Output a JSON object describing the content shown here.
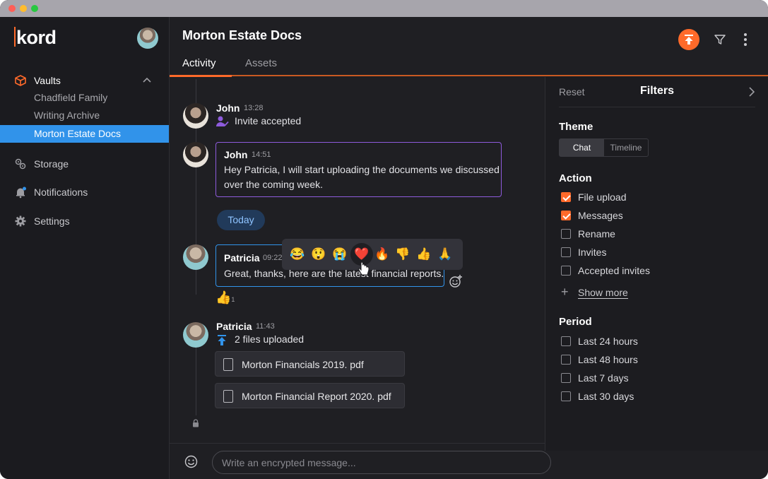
{
  "app": {
    "logo_text": "kord",
    "accent": "#ff6a2a"
  },
  "sidebar": {
    "vaults_label": "Vaults",
    "vaults": [
      "Chadfield Family",
      "Writing Archive",
      "Morton Estate Docs"
    ],
    "active_vault": "Morton Estate Docs",
    "storage_label": "Storage",
    "notifications_label": "Notifications",
    "settings_label": "Settings"
  },
  "header": {
    "title": "Morton Estate Docs",
    "tabs": [
      "Activity",
      "Assets"
    ],
    "active_tab": "Activity"
  },
  "chat": {
    "messages": [
      {
        "author": "John",
        "time": "13:28",
        "event": "Invite accepted"
      },
      {
        "author": "John",
        "time": "14:51",
        "text_lines": [
          "Hey Patricia, I will start uploading the documents we discussed",
          "over the coming week."
        ]
      },
      {
        "author": "Patricia",
        "time": "09:22",
        "text": "Great, thanks, here are the latest financial reports.",
        "reaction": "👍",
        "reaction_count": "1"
      },
      {
        "author": "Patricia",
        "time": "11:43",
        "event": "2 files uploaded"
      }
    ],
    "day_divider": "Today",
    "emoji_picker": [
      "😂",
      "😲",
      "😭",
      "❤️",
      "🔥",
      "👎",
      "👍",
      "🙏"
    ],
    "files": [
      "Morton Financials 2019. pdf",
      "Morton Financial Report 2020. pdf"
    ],
    "composer_placeholder": "Write an encrypted message..."
  },
  "filters": {
    "reset_label": "Reset",
    "title": "Filters",
    "theme_label": "Theme",
    "theme_options": [
      "Chat",
      "Timeline"
    ],
    "theme_selected": "Chat",
    "action_label": "Action",
    "actions": [
      {
        "label": "File upload",
        "checked": true
      },
      {
        "label": "Messages",
        "checked": true
      },
      {
        "label": "Rename",
        "checked": false
      },
      {
        "label": "Invites",
        "checked": false
      },
      {
        "label": "Accepted invites",
        "checked": false
      }
    ],
    "show_more_label": "Show more",
    "period_label": "Period",
    "periods": [
      {
        "label": "Last 24 hours",
        "checked": false
      },
      {
        "label": "Last 48 hours",
        "checked": false
      },
      {
        "label": "Last 7 days",
        "checked": false
      },
      {
        "label": "Last 30 days",
        "checked": false
      }
    ]
  }
}
